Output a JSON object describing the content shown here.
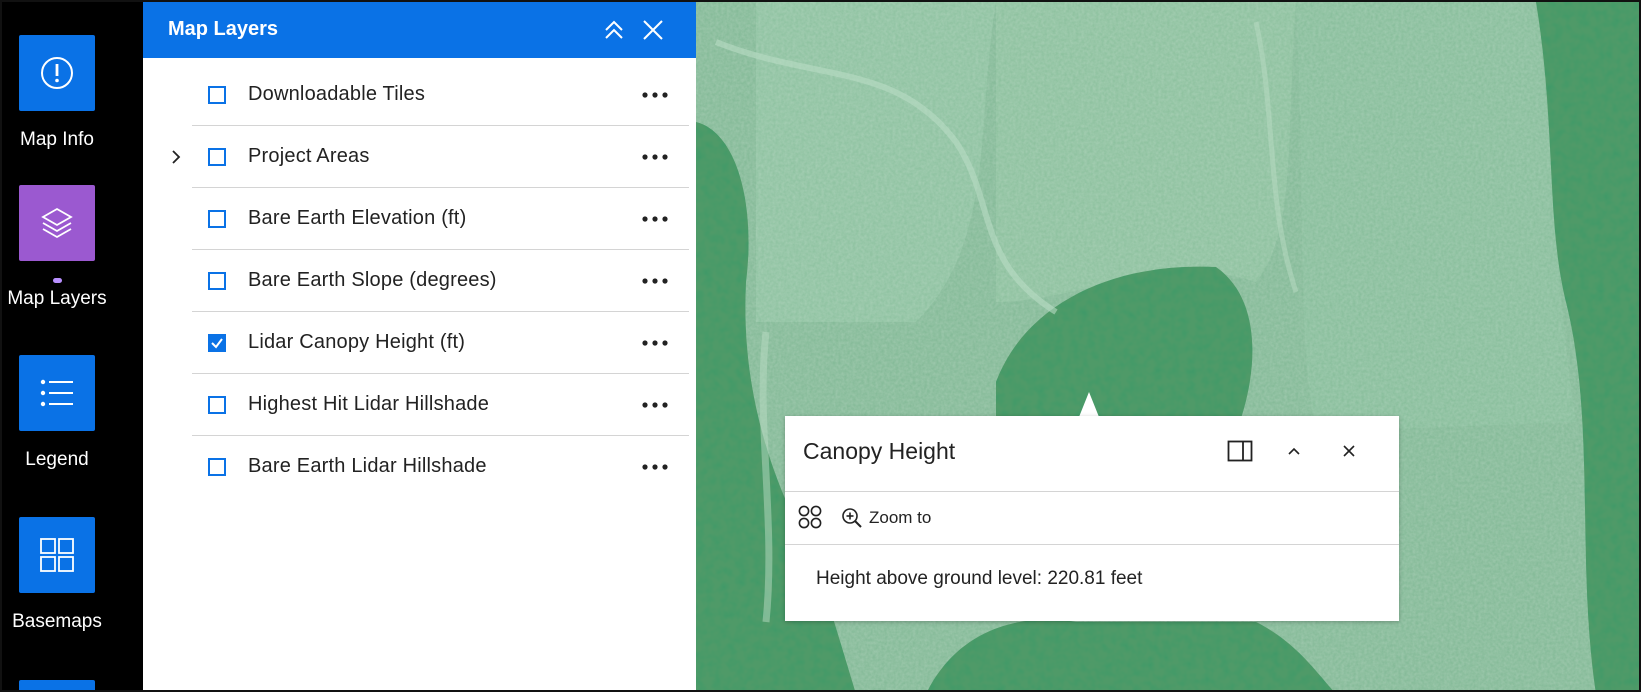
{
  "toolbar": {
    "items": [
      {
        "label": "Map Info",
        "icon": "info-icon",
        "color": "#0a72e6"
      },
      {
        "label": "Map Layers",
        "icon": "layers-icon",
        "color": "#9b59d0",
        "active": true
      },
      {
        "label": "Legend",
        "icon": "list-icon",
        "color": "#0a72e6"
      },
      {
        "label": "Basemaps",
        "icon": "grid-icon",
        "color": "#0a72e6"
      }
    ]
  },
  "panel": {
    "title": "Map Layers",
    "header_color": "#0a72e6",
    "layers": [
      {
        "name": "Downloadable Tiles",
        "checked": false,
        "expandable": false
      },
      {
        "name": "Project Areas",
        "checked": false,
        "expandable": true
      },
      {
        "name": "Bare Earth Elevation (ft)",
        "checked": false,
        "expandable": false
      },
      {
        "name": "Bare Earth Slope (degrees)",
        "checked": false,
        "expandable": false
      },
      {
        "name": "Lidar Canopy Height (ft)",
        "checked": true,
        "expandable": false
      },
      {
        "name": "Highest Hit Lidar Hillshade",
        "checked": false,
        "expandable": false
      },
      {
        "name": "Bare Earth Lidar Hillshade",
        "checked": false,
        "expandable": false
      }
    ]
  },
  "popup": {
    "title": "Canopy Height",
    "zoom_to_label": "Zoom to",
    "content": "Height above ground level: 220.81 feet"
  }
}
